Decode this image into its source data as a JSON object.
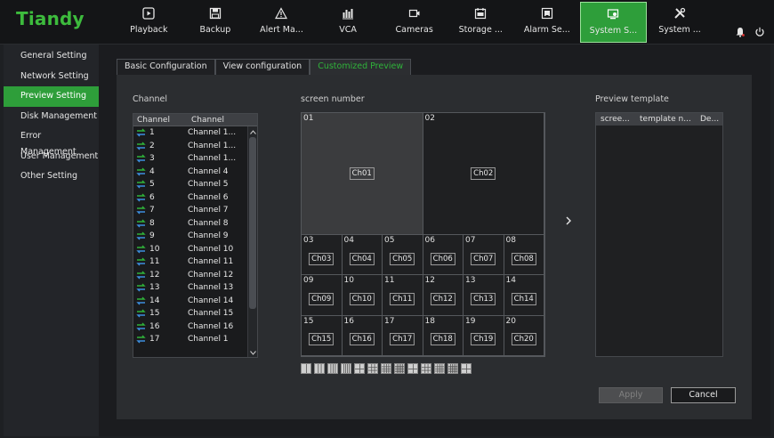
{
  "app": {
    "logo": "Tiandy"
  },
  "nav": [
    {
      "label": "Playback",
      "icon": "playback-icon"
    },
    {
      "label": "Backup",
      "icon": "save-icon"
    },
    {
      "label": "Alert Ma...",
      "icon": "alert-icon"
    },
    {
      "label": "VCA",
      "icon": "vca-icon"
    },
    {
      "label": "Cameras",
      "icon": "camera-icon"
    },
    {
      "label": "Storage ...",
      "icon": "storage-icon"
    },
    {
      "label": "Alarm Se...",
      "icon": "alarm-icon"
    },
    {
      "label": "System S...",
      "icon": "system-settings-icon",
      "active": true
    },
    {
      "label": "System ...",
      "icon": "tools-icon"
    }
  ],
  "colors": {
    "accent": "#2e9e3a",
    "logo": "#3dbb3d",
    "active_tab": "#2fb33a"
  },
  "sidebar": [
    {
      "label": "General Setting"
    },
    {
      "label": "Network Setting"
    },
    {
      "label": "Preview Setting",
      "active": true
    },
    {
      "label": "Disk Management"
    },
    {
      "label": "Error Management"
    },
    {
      "label": "User Management"
    },
    {
      "label": "Other Setting"
    }
  ],
  "tabs": [
    {
      "label": "Basic Configuration"
    },
    {
      "label": "View configuration"
    },
    {
      "label": "Customized Preview",
      "active": true
    }
  ],
  "channel_section": {
    "label": "Channel",
    "headers": [
      "Channel",
      "Channel"
    ],
    "rows": [
      {
        "num": "1",
        "name": "Channel 1..."
      },
      {
        "num": "2",
        "name": "Channel 1..."
      },
      {
        "num": "3",
        "name": "Channel 1..."
      },
      {
        "num": "4",
        "name": "Channel 4"
      },
      {
        "num": "5",
        "name": "Channel 5"
      },
      {
        "num": "6",
        "name": "Channel 6"
      },
      {
        "num": "7",
        "name": "Channel 7"
      },
      {
        "num": "8",
        "name": "Channel 8"
      },
      {
        "num": "9",
        "name": "Channel 9"
      },
      {
        "num": "10",
        "name": "Channel 10"
      },
      {
        "num": "11",
        "name": "Channel 11"
      },
      {
        "num": "12",
        "name": "Channel 12"
      },
      {
        "num": "13",
        "name": "Channel 13"
      },
      {
        "num": "14",
        "name": "Channel 14"
      },
      {
        "num": "15",
        "name": "Channel 15"
      },
      {
        "num": "16",
        "name": "Channel 16"
      },
      {
        "num": "17",
        "name": "Channel 1"
      }
    ]
  },
  "screen_section": {
    "label": "screen number",
    "big_cells": [
      {
        "num": "01",
        "ch": "Ch01"
      },
      {
        "num": "02",
        "ch": "Ch02"
      }
    ],
    "small_cells": [
      {
        "num": "03",
        "ch": "Ch03"
      },
      {
        "num": "04",
        "ch": "Ch04"
      },
      {
        "num": "05",
        "ch": "Ch05"
      },
      {
        "num": "06",
        "ch": "Ch06"
      },
      {
        "num": "07",
        "ch": "Ch07"
      },
      {
        "num": "08",
        "ch": "Ch08"
      },
      {
        "num": "09",
        "ch": "Ch09"
      },
      {
        "num": "10",
        "ch": "Ch10"
      },
      {
        "num": "11",
        "ch": "Ch11"
      },
      {
        "num": "12",
        "ch": "Ch12"
      },
      {
        "num": "13",
        "ch": "Ch13"
      },
      {
        "num": "14",
        "ch": "Ch14"
      },
      {
        "num": "15",
        "ch": "Ch15"
      },
      {
        "num": "16",
        "ch": "Ch16"
      },
      {
        "num": "17",
        "ch": "Ch17"
      },
      {
        "num": "18",
        "ch": "Ch18"
      },
      {
        "num": "19",
        "ch": "Ch19"
      },
      {
        "num": "20",
        "ch": "Ch20"
      }
    ]
  },
  "template_section": {
    "label": "Preview template",
    "headers": [
      "scree...",
      "template n...",
      "De..."
    ]
  },
  "buttons": {
    "apply": "Apply",
    "cancel": "Cancel"
  }
}
